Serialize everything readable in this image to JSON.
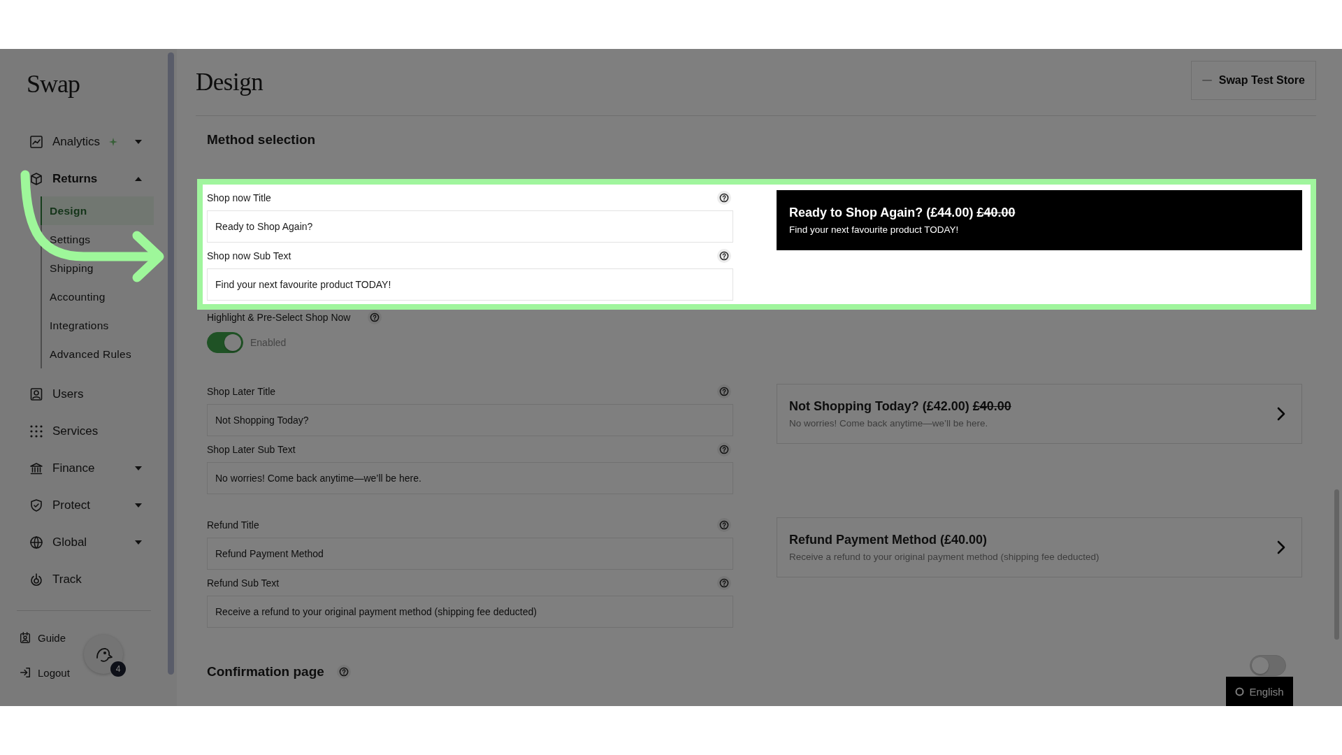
{
  "sidebar": {
    "logo": "Swap",
    "items": [
      {
        "label": "Analytics",
        "kind": "group",
        "expanded": false
      },
      {
        "label": "Returns",
        "kind": "group",
        "expanded": true,
        "children": [
          {
            "label": "Design",
            "selected": true
          },
          {
            "label": "Settings",
            "selected": false
          },
          {
            "label": "Shipping",
            "selected": false
          },
          {
            "label": "Accounting",
            "selected": false
          },
          {
            "label": "Integrations",
            "selected": false
          },
          {
            "label": "Advanced Rules",
            "selected": false
          }
        ]
      },
      {
        "label": "Users",
        "kind": "link"
      },
      {
        "label": "Services",
        "kind": "link"
      },
      {
        "label": "Finance",
        "kind": "group",
        "expanded": false
      },
      {
        "label": "Protect",
        "kind": "group",
        "expanded": false
      },
      {
        "label": "Global",
        "kind": "group",
        "expanded": false
      },
      {
        "label": "Track",
        "kind": "link"
      }
    ],
    "footer_items": [
      {
        "label": "Guide"
      },
      {
        "label": "Logout"
      }
    ]
  },
  "chat_widget": {
    "badge": "4"
  },
  "page": {
    "title": "Design",
    "store_button": "Swap Test Store",
    "section_title": "Method selection",
    "blocks": [
      {
        "kind": "option",
        "spotlit": true,
        "fields": [
          {
            "label": "Shop now Title",
            "value": "Ready to Shop Again?"
          },
          {
            "label": "Shop now Sub Text",
            "value": "Find your next favourite product TODAY!"
          }
        ],
        "preview": {
          "title": "Ready to Shop Again? (£44.00)",
          "old_price": "£40.00",
          "subtitle": "Find your next favourite product TODAY!",
          "highlighted": true
        }
      },
      {
        "kind": "toggle",
        "label": "Highlight & Pre-Select Shop Now",
        "on": true,
        "status": "Enabled"
      },
      {
        "kind": "option",
        "spotlit": false,
        "fields": [
          {
            "label": "Shop Later Title",
            "value": "Not Shopping Today?"
          },
          {
            "label": "Shop Later Sub Text",
            "value": "No worries! Come back anytime—we’ll be here."
          }
        ],
        "preview": {
          "title": "Not Shopping Today? (£42.00)",
          "old_price": "£40.00",
          "subtitle": "No worries! Come back anytime—we’ll be here.",
          "highlighted": false
        }
      },
      {
        "kind": "option",
        "spotlit": false,
        "fields": [
          {
            "label": "Refund Title",
            "value": "Refund Payment Method"
          },
          {
            "label": "Refund Sub Text",
            "value": "Receive a refund to your original payment method (shipping fee deducted)"
          }
        ],
        "preview": {
          "title": "Refund Payment Method (£40.00)",
          "subtitle": "Receive a refund to your original payment method (shipping fee deducted)",
          "highlighted": false
        }
      }
    ],
    "confirmation": {
      "title": "Confirmation page",
      "on": false
    }
  },
  "language_button": "English"
}
